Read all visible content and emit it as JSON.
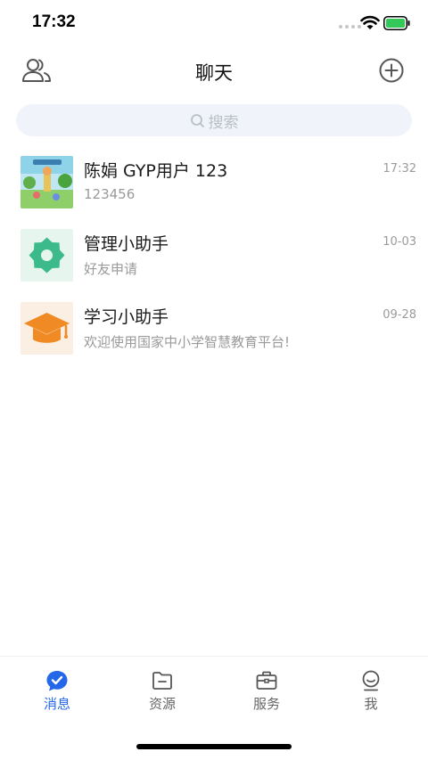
{
  "status_bar": {
    "time": "17:32"
  },
  "header": {
    "title": "聊天",
    "left_icon": "contacts-icon",
    "right_icon": "add-circle-icon"
  },
  "search": {
    "placeholder": "搜索"
  },
  "chats": [
    {
      "name": "陈娟 GYP用户 123",
      "preview": "123456",
      "time": "17:32",
      "avatar": "photo-avatar"
    },
    {
      "name": "管理小助手",
      "preview": "好友申请",
      "time": "10-03",
      "avatar": "gear-badge-icon"
    },
    {
      "name": "学习小助手",
      "preview": "欢迎使用国家中小学智慧教育平台!",
      "time": "09-28",
      "avatar": "graduation-cap-icon"
    }
  ],
  "tabs": [
    {
      "label": "消息",
      "icon": "chat-bubble-check-icon",
      "active": true
    },
    {
      "label": "资源",
      "icon": "folder-icon",
      "active": false
    },
    {
      "label": "服务",
      "icon": "briefcase-icon",
      "active": false
    },
    {
      "label": "我",
      "icon": "user-face-icon",
      "active": false
    }
  ],
  "colors": {
    "accent": "#2467e8",
    "search_bg": "#f0f4fa",
    "gear_green": "#3dba8c",
    "cap_orange": "#f08a24"
  }
}
